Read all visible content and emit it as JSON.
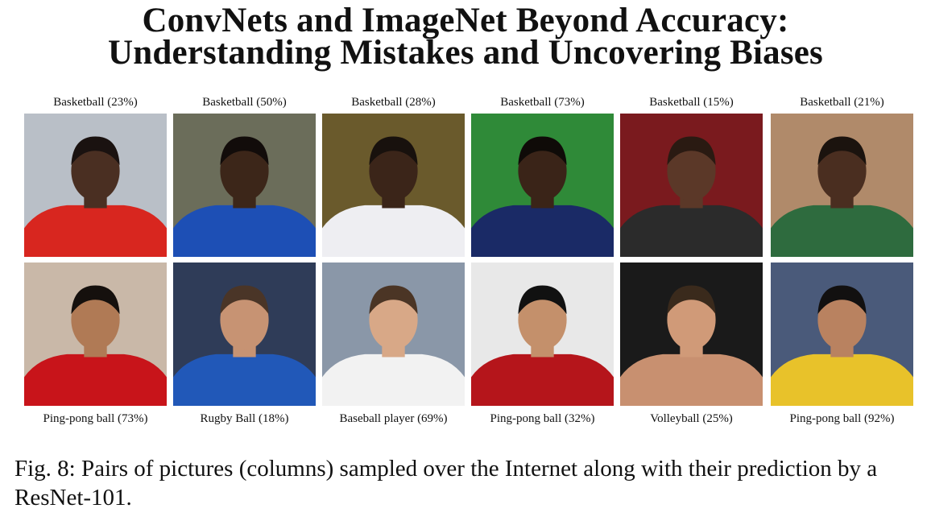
{
  "title": {
    "line1": "ConvNets and ImageNet Beyond Accuracy:",
    "line2": "Understanding Mistakes and Uncovering Biases"
  },
  "columns": [
    {
      "top": {
        "label": "Basketball (23%)",
        "bg": "#b9bfc7",
        "shirt": "#d8261f",
        "skin": "#4a2f22",
        "hair": "#1a1210"
      },
      "bottom": {
        "label": "Ping-pong ball (73%)",
        "bg": "#c9b8a8",
        "shirt": "#c8141a",
        "skin": "#b07a55",
        "hair": "#15100d"
      }
    },
    {
      "top": {
        "label": "Basketball (50%)",
        "bg": "#6b6d5a",
        "shirt": "#1d4fb5",
        "skin": "#3c2619",
        "hair": "#120c0a"
      },
      "bottom": {
        "label": "Rugby Ball (18%)",
        "bg": "#2f3c58",
        "shirt": "#2158b8",
        "skin": "#c79373",
        "hair": "#4a3527"
      }
    },
    {
      "top": {
        "label": "Basketball (28%)",
        "bg": "#6a5a2c",
        "shirt": "#eeeef2",
        "skin": "#3b2519",
        "hair": "#18110d"
      },
      "bottom": {
        "label": "Baseball player (69%)",
        "bg": "#8a97a8",
        "shirt": "#f2f2f2",
        "skin": "#d8a887",
        "hair": "#4b3525"
      }
    },
    {
      "top": {
        "label": "Basketball (73%)",
        "bg": "#2f8a38",
        "shirt": "#1a2a66",
        "skin": "#3a2418",
        "hair": "#0f0b08"
      },
      "bottom": {
        "label": "Ping-pong ball (32%)",
        "bg": "#e8e8e8",
        "shirt": "#b5151b",
        "skin": "#c4906b",
        "hair": "#111111"
      }
    },
    {
      "top": {
        "label": "Basketball (15%)",
        "bg": "#7a1a1e",
        "shirt": "#2b2b2b",
        "skin": "#5b3828",
        "hair": "#2a1a12"
      },
      "bottom": {
        "label": "Volleyball (25%)",
        "bg": "#1a1a1a",
        "shirt": "#c89070",
        "skin": "#d09a78",
        "hair": "#3a2a1c"
      }
    },
    {
      "top": {
        "label": "Basketball (21%)",
        "bg": "#b08a6a",
        "shirt": "#2e6b3e",
        "skin": "#4a2e20",
        "hair": "#1b130e"
      },
      "bottom": {
        "label": "Ping-pong ball (92%)",
        "bg": "#4a5a7a",
        "shirt": "#e8c22a",
        "skin": "#b98260",
        "hair": "#121010"
      }
    }
  ],
  "caption": "Fig. 8: Pairs of pictures (columns) sampled over the Internet along with their prediction by a ResNet-101."
}
